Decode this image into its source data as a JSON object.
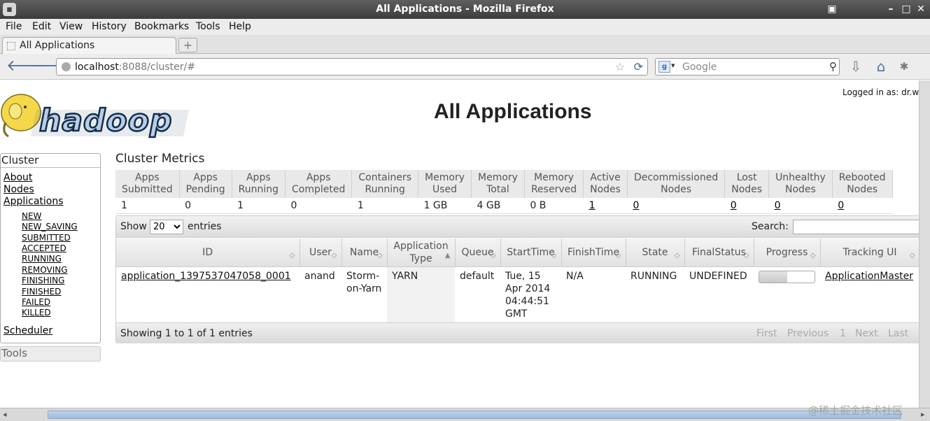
{
  "window": {
    "title": "All Applications - Mozilla Firefox"
  },
  "menu": [
    "File",
    "Edit",
    "View",
    "History",
    "Bookmarks",
    "Tools",
    "Help"
  ],
  "tab": {
    "label": "All Applications",
    "new_tab": "+"
  },
  "nav": {
    "url_host": "localhost",
    "url_path": ":8088/cluster/#",
    "search_engine": "Google",
    "search_placeholder": "Google"
  },
  "page": {
    "logged_in": "Logged in as: dr.who",
    "title": "All Applications",
    "logo_text": "hadoop"
  },
  "sidebar": {
    "cluster_header": "Cluster",
    "links": [
      "About",
      "Nodes",
      "Applications"
    ],
    "states": [
      "NEW",
      "NEW_SAVING",
      "SUBMITTED",
      "ACCEPTED",
      "RUNNING",
      "REMOVING",
      "FINISHING",
      "FINISHED",
      "FAILED",
      "KILLED"
    ],
    "scheduler": "Scheduler",
    "tools_header": "Tools"
  },
  "metrics": {
    "title": "Cluster Metrics",
    "headers": [
      [
        "Apps",
        "Submitted"
      ],
      [
        "Apps",
        "Pending"
      ],
      [
        "Apps",
        "Running"
      ],
      [
        "Apps",
        "Completed"
      ],
      [
        "Containers",
        "Running"
      ],
      [
        "Memory",
        "Used"
      ],
      [
        "Memory",
        "Total"
      ],
      [
        "Memory",
        "Reserved"
      ],
      [
        "Active",
        "Nodes"
      ],
      [
        "Decommissioned",
        "Nodes"
      ],
      [
        "Lost",
        "Nodes"
      ],
      [
        "Unhealthy",
        "Nodes"
      ],
      [
        "Rebooted",
        "Nodes"
      ]
    ],
    "values": [
      "1",
      "0",
      "1",
      "0",
      "1",
      "1 GB",
      "4 GB",
      "0 B",
      "1",
      "0",
      "0",
      "0",
      "0"
    ]
  },
  "apps": {
    "show_label": "Show",
    "page_size": "20",
    "entries_label": "entries",
    "search_label": "Search:",
    "headers": [
      [
        "ID"
      ],
      [
        "User"
      ],
      [
        "Name"
      ],
      [
        "Application",
        "Type"
      ],
      [
        "Queue"
      ],
      [
        "StartTime"
      ],
      [
        "FinishTime"
      ],
      [
        "State"
      ],
      [
        "FinalStatus"
      ],
      [
        "Progress"
      ],
      [
        "Tracking UI"
      ]
    ],
    "rows": [
      {
        "id": "application_1397537047058_0001",
        "user": "anand",
        "name": "Storm-\non-Yarn",
        "type": "YARN",
        "queue": "default",
        "start": "Tue, 15\nApr 2014\n04:44:51\nGMT",
        "finish": "N/A",
        "state": "RUNNING",
        "final_status": "UNDEFINED",
        "progress": 0.5,
        "tracking": "ApplicationMaster"
      }
    ],
    "info": "Showing 1 to 1 of 1 entries",
    "paging": {
      "first": "First",
      "previous": "Previous",
      "page": "1",
      "next": "Next",
      "last": "Last"
    }
  },
  "watermark": "@稀土掘金技术社区"
}
